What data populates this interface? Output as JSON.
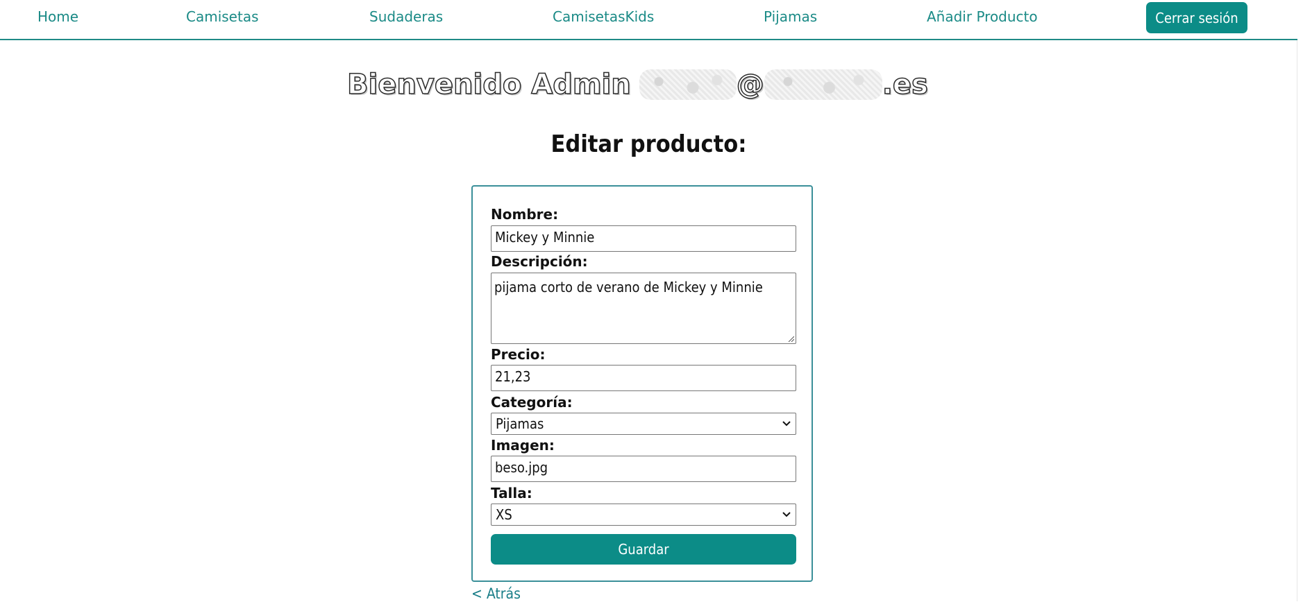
{
  "nav": {
    "links": [
      "Home",
      "Camisetas",
      "Sudaderas",
      "CamisetasKids",
      "Pijamas",
      "Añadir Producto"
    ],
    "logout_label": "Cerrar sesión"
  },
  "welcome": {
    "prefix": "Bienvenido Admin",
    "at": "@",
    "suffix": ".es"
  },
  "page_title": "Editar producto:",
  "form": {
    "name_label": "Nombre:",
    "name_value": "Mickey y  Minnie",
    "description_label": "Descripción:",
    "description_value": "pijama corto de verano de Mickey y Minnie",
    "price_label": "Precio:",
    "price_value": "21,23",
    "category_label": "Categoría:",
    "category_value": "Pijamas",
    "image_label": "Imagen:",
    "image_value": "beso.jpg",
    "size_label": "Talla:",
    "size_value": "XS",
    "save_label": "Guardar"
  },
  "back_label": "< Atrás",
  "colors": {
    "accent": "#0c8c87",
    "nav_text": "#1a8a86",
    "card_border": "#3a8f99"
  }
}
